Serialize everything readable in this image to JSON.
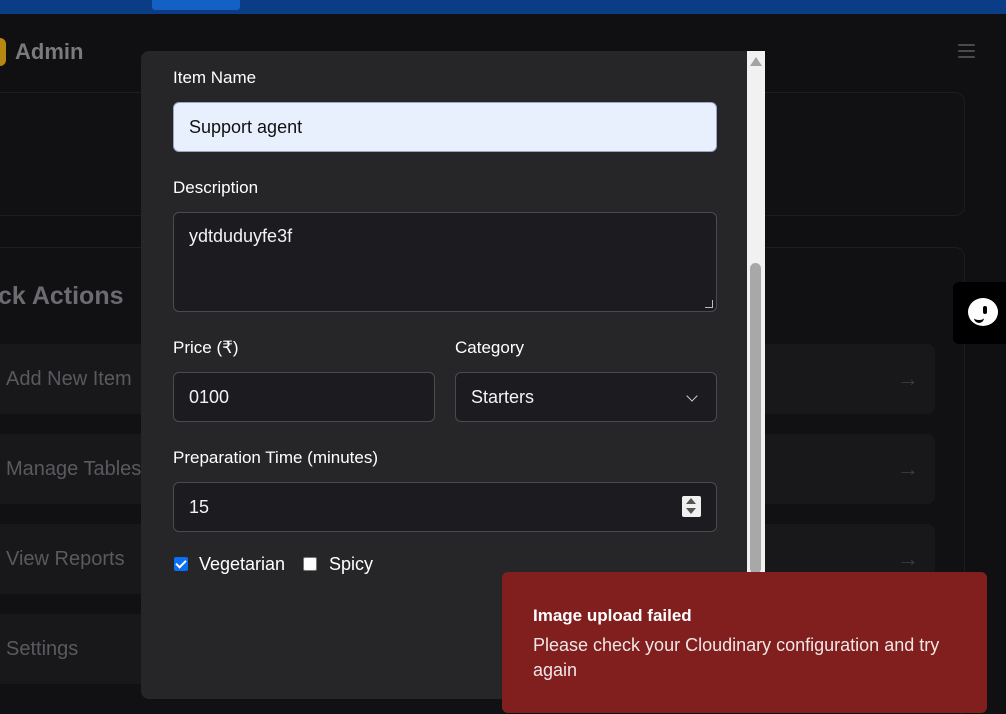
{
  "browser": {
    "tab_active": ""
  },
  "app": {
    "brand": "Admin",
    "quick_actions_title": "ck Actions",
    "quick_actions": [
      {
        "label": "Add New Item",
        "arrow": "→"
      },
      {
        "label": "Manage Tables",
        "arrow": "→"
      },
      {
        "label": "View Reports",
        "arrow": "→"
      },
      {
        "label": "Settings",
        "arrow": ""
      }
    ]
  },
  "form": {
    "item_name_label": "Item Name",
    "item_name_value": "Support agent",
    "description_label": "Description",
    "description_value": "ydtduduyfe3f",
    "price_label": "Price (₹)",
    "price_value": "0100",
    "category_label": "Category",
    "category_value": "Starters",
    "prep_label": "Preparation Time (minutes)",
    "prep_value": "15",
    "vegetarian_label": "Vegetarian",
    "vegetarian_checked": true,
    "spicy_label": "Spicy",
    "spicy_checked": false
  },
  "toast": {
    "title": "Image upload failed",
    "message": "Please check your Cloudinary configuration and try again",
    "color": "#811f1f"
  },
  "colors": {
    "accent_checkbox": "#0b6ff5",
    "modal_bg": "#262629",
    "topbar": "#0a3d86"
  },
  "icons": [
    "menu-icon",
    "chat-support-icon",
    "chevron-down-icon",
    "number-spinner-icon",
    "scroll-up-icon"
  ]
}
